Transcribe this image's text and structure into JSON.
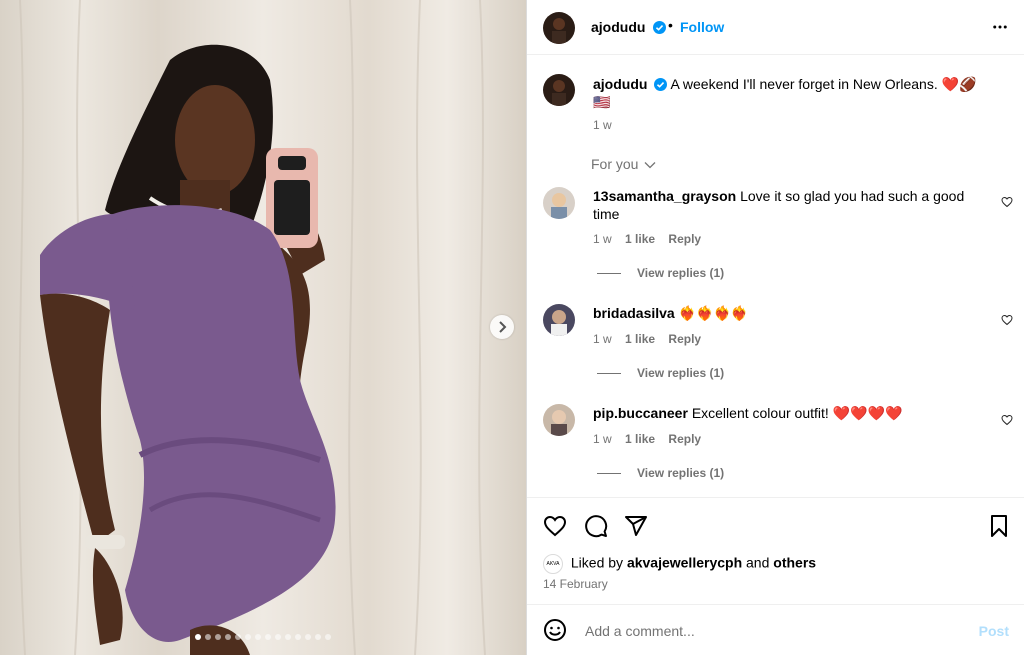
{
  "post": {
    "author": "ajodudu",
    "follow_label": "Follow",
    "caption": "A weekend I'll never forget in New Orleans. ❤️🏈",
    "caption_line2": "🇺🇸",
    "caption_time": "1 w",
    "sort_label": "For you"
  },
  "comments": [
    {
      "user": "13samantha_grayson",
      "text": "Love it so glad you had such a good",
      "text2": "time",
      "time": "1 w",
      "likes": "1 like",
      "reply": "Reply",
      "view_replies": "View replies (1)"
    },
    {
      "user": "bridadasilva",
      "text": "❤️‍🔥❤️‍🔥❤️‍🔥❤️‍🔥",
      "text2": "",
      "time": "1 w",
      "likes": "1 like",
      "reply": "Reply",
      "view_replies": "View replies (1)"
    },
    {
      "user": "pip.buccaneer",
      "text": "Excellent colour outfit! ❤️❤️❤️❤️",
      "text2": "",
      "time": "1 w",
      "likes": "1 like",
      "reply": "Reply",
      "view_replies": "View replies (1)"
    }
  ],
  "likes": {
    "prefix": "Liked by",
    "user": "akvajewellerycph",
    "and": "and",
    "others": "others",
    "liker_avatar_text": "AKVA",
    "date": "14 February"
  },
  "composer": {
    "placeholder": "Add a comment...",
    "post_label": "Post"
  },
  "carousel": {
    "slide_count": 14,
    "active_index": 0
  },
  "colors": {
    "accent": "#0095f6",
    "post_disabled": "#b2dffc",
    "dress": "#7a5a8e"
  },
  "icons": [
    "verified-badge-icon",
    "more-options-icon",
    "heart-icon",
    "comment-icon",
    "share-icon",
    "bookmark-icon",
    "emoji-icon",
    "chevron-right-icon",
    "chevron-down-icon"
  ]
}
